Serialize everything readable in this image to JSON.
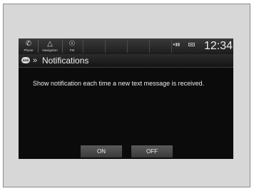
{
  "statusbar": {
    "phone": {
      "icon": "phone-icon",
      "label": "Phone"
    },
    "navigation": {
      "icon": "navigation-icon",
      "label": "Navigation"
    },
    "fm": {
      "icon": "radio-antenna-icon",
      "label": "FM"
    },
    "clock": "12:34"
  },
  "titlebar": {
    "app_icon": "sms-icon",
    "title": "Notifications"
  },
  "message": "Show notification each time a new text message is received.",
  "buttons": {
    "on": "ON",
    "off": "OFF"
  },
  "colors": {
    "screen_bg": "#0b0b0b",
    "frame_bg": "#d7d7d7",
    "button_bg": "#4a4a4a",
    "text": "#ececec"
  }
}
